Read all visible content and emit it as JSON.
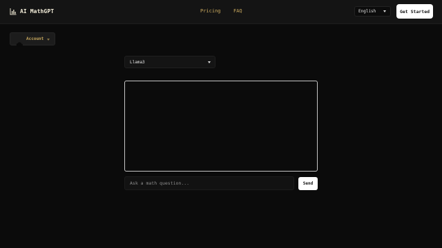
{
  "header": {
    "brand_name": "AI MathGPT",
    "brand_icon": "bar-chart-icon",
    "nav": [
      {
        "label": "Pricing"
      },
      {
        "label": "FAQ"
      }
    ],
    "language": "English",
    "cta_label": "Get Started"
  },
  "sidebar": {
    "account_label": "Account"
  },
  "main": {
    "model": "Llama3",
    "input_placeholder": "Ask a math question...",
    "send_label": "Send"
  },
  "colors": {
    "background": "#0b0b0b",
    "navbar": "#141414",
    "accent_gold": "#c9a95e",
    "button_bg": "#ffffff"
  }
}
